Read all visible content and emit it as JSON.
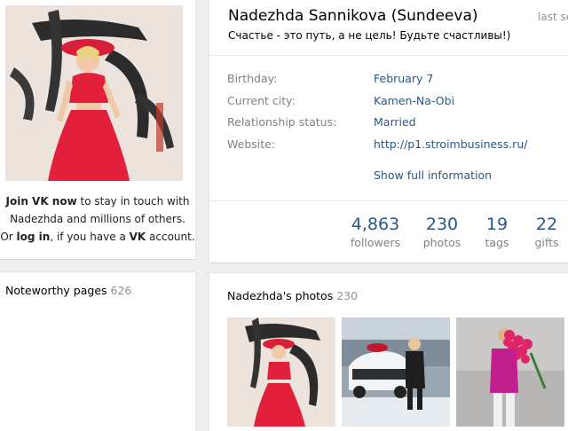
{
  "join": {
    "join_link": "Join VK now",
    "line1_rest": " to stay in touch with",
    "line2": "Nadezhda and millions of others.",
    "or": "Or ",
    "login_link": "log in",
    "mid": ", if you have a ",
    "vk": "VK",
    "end": " account."
  },
  "noteworthy": {
    "label": "Noteworthy pages",
    "count": "626"
  },
  "profile": {
    "name": "Nadezhda Sannikova (Sundeeva)",
    "last_seen": "last se",
    "status": "Счастье - это путь, а не цель! Будьте счастливы!)",
    "info": [
      {
        "label": "Birthday:",
        "value": "February 7"
      },
      {
        "label": "Current city:",
        "value": "Kamen-Na-Obi"
      },
      {
        "label": "Relationship status:",
        "value": "Married"
      },
      {
        "label": "Website:",
        "value": "http://p1.stroimbusiness.ru/"
      }
    ],
    "show_full": "Show full information",
    "stats": [
      {
        "num": "4,863",
        "label": "followers"
      },
      {
        "num": "230",
        "label": "photos"
      },
      {
        "num": "19",
        "label": "tags"
      },
      {
        "num": "22",
        "label": "gifts"
      }
    ]
  },
  "photos": {
    "label": "Nadezhda's photos",
    "count": "230"
  },
  "colors": {
    "link": "#2a5885",
    "muted": "#828282",
    "background": "#edeef0"
  }
}
